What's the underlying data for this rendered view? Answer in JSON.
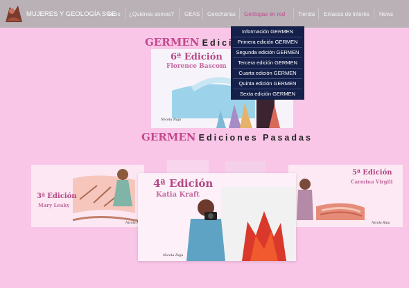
{
  "header": {
    "brand": "MUJERES Y GEOLOGÍA SGE",
    "nav": [
      "Inicio",
      "¿Quiénes somos?",
      "GEAS",
      "Geocharlas",
      "Geólogas en red",
      "Tienda",
      "Enlaces de interés",
      "News"
    ]
  },
  "dropdown": {
    "items": [
      "Información GERMEN",
      "Primera edición GERMEN",
      "Segunda edición GERMEN",
      "Tercera edición GERMEN",
      "Cuarta edición GERMEN",
      "Quinta edición GERMEN",
      "Sexta edición GERMEN"
    ]
  },
  "main": {
    "heading1_pink": "GERMEN",
    "heading1_dark": "Edició",
    "heading2_pink": "GERMEN",
    "heading2_dark": "Ediciones Pasadas"
  },
  "cards": {
    "sixth": {
      "edition": "6ª Edición",
      "name": "Florence Bascom",
      "signature": "Nicola Raja"
    },
    "third": {
      "edition": "3ª Edición",
      "name": "Mary Leaky",
      "signature": "Nicola Raja"
    },
    "fourth": {
      "edition": "4ª Edición",
      "name": "Katia Kraft",
      "signature": "Nicola Raja"
    },
    "fifth": {
      "edition": "5ª Edición",
      "name": "Carmina Virgili",
      "signature": "Nicola Raja"
    }
  }
}
